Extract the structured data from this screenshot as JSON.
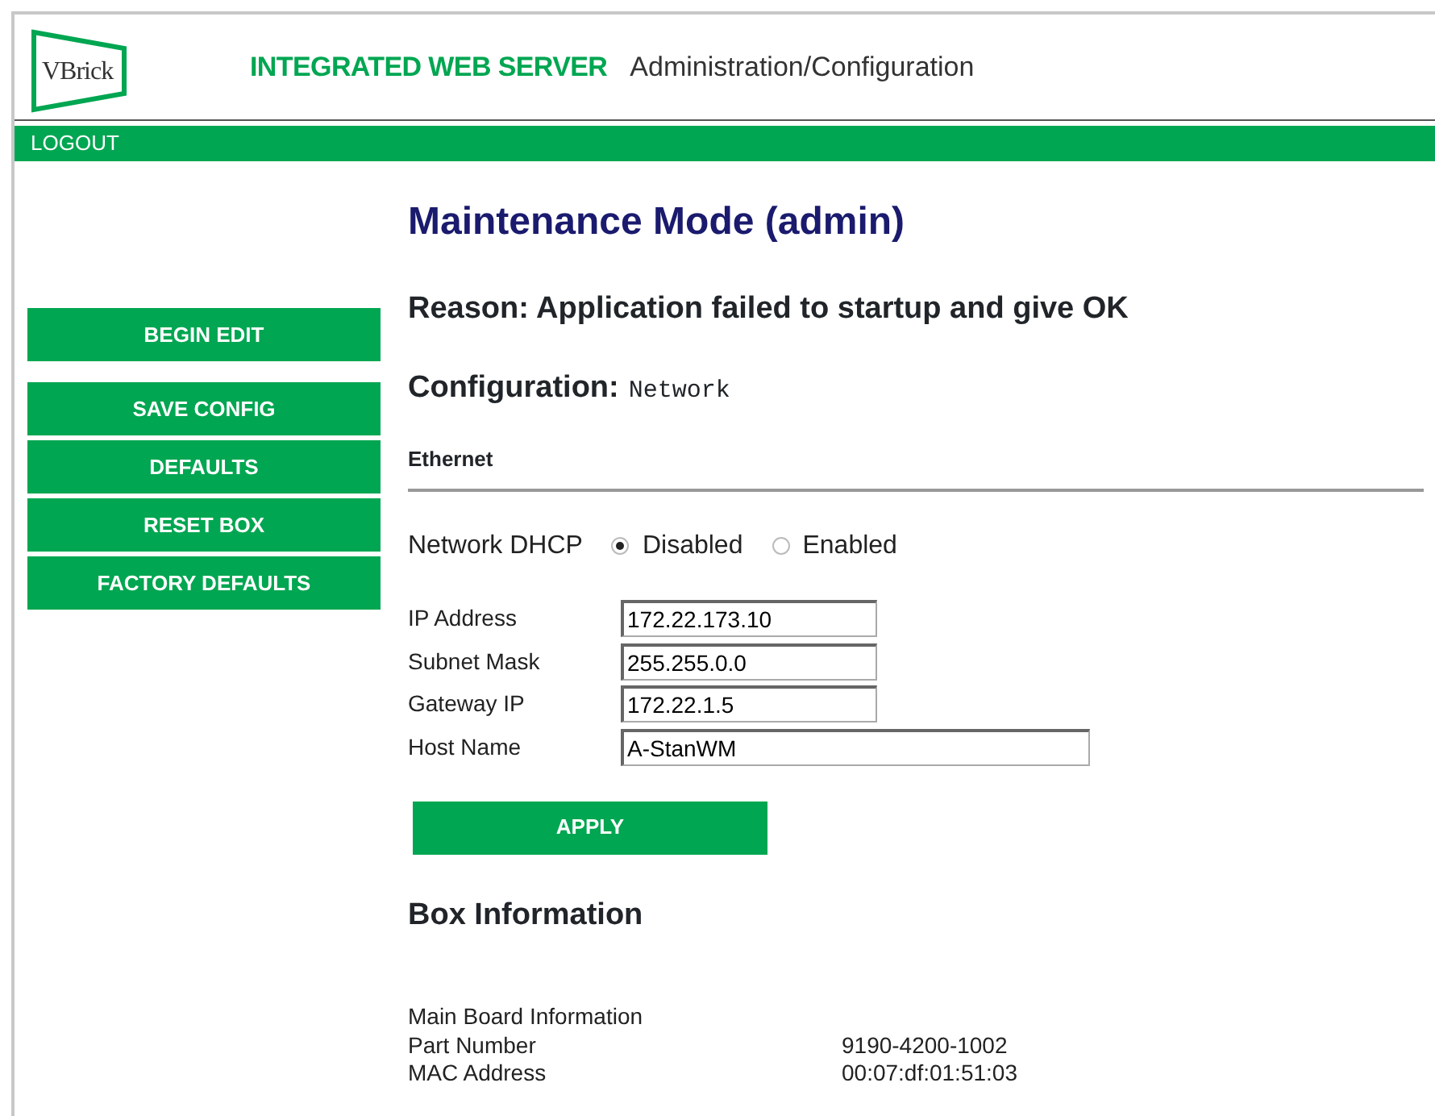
{
  "header": {
    "logo": "VBrick",
    "product": "INTEGRATED WEB SERVER",
    "section": "Administration/Configuration"
  },
  "menu_bar": [
    "LOGOUT"
  ],
  "sidebar": [
    {
      "label": "BEGIN EDIT"
    },
    {
      "label": "SAVE CONFIG"
    },
    {
      "label": "DEFAULTS"
    },
    {
      "label": "RESET BOX"
    },
    {
      "label": "FACTORY DEFAULTS"
    }
  ],
  "title": "Maintenance Mode (admin)",
  "reason": "Reason: Application failed to startup and give OK",
  "configuration": {
    "label": "Configuration:",
    "value": "Network"
  },
  "section": "Ethernet",
  "dhcp": {
    "label": "Network DHCP",
    "options": [
      {
        "label": "Disabled",
        "selected": true
      },
      {
        "label": "Enabled",
        "selected": false
      }
    ]
  },
  "fields": [
    {
      "label": "IP Address",
      "value": "172.22.173.10",
      "kind": "short"
    },
    {
      "label": "Subnet Mask",
      "value": "255.255.0.0",
      "kind": "short"
    },
    {
      "label": "Gateway IP",
      "value": "172.22.1.5",
      "kind": "short"
    },
    {
      "label": "Host Name",
      "value": "A-StanWM",
      "kind": "long"
    }
  ],
  "apply_button": "APPLY",
  "box_information": {
    "title": "Box Information",
    "heading": "Main Board Information",
    "rows": [
      {
        "label": "Part Number",
        "value": "9190-4200-1002"
      },
      {
        "label": "MAC Address",
        "value": "00:07:df:01:51:03"
      }
    ]
  }
}
